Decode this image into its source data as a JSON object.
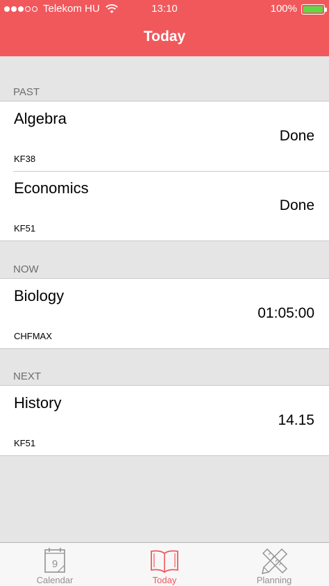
{
  "status_bar": {
    "carrier": "Telekom HU",
    "time": "13:10",
    "battery_percent": "100%",
    "signal_bars_filled": 3,
    "signal_bars_total": 5,
    "battery_level": 1.0
  },
  "nav": {
    "title": "Today"
  },
  "sections": [
    {
      "header": "PAST",
      "rows": [
        {
          "title": "Algebra",
          "status": "Done",
          "room": "KF38"
        },
        {
          "title": "Economics",
          "status": "Done",
          "room": "KF51"
        }
      ]
    },
    {
      "header": "NOW",
      "rows": [
        {
          "title": "Biology",
          "status": "01:05:00",
          "room": "CHFMAX"
        }
      ]
    },
    {
      "header": "NEXT",
      "rows": [
        {
          "title": "History",
          "status": "14.15",
          "room": "KF51"
        }
      ]
    }
  ],
  "tabbar": {
    "tabs": [
      {
        "label": "Calendar",
        "icon": "calendar-icon",
        "icon_text": "9"
      },
      {
        "label": "Today",
        "icon": "book-icon"
      },
      {
        "label": "Planning",
        "icon": "pencil-ruler-icon"
      }
    ],
    "active": "Today"
  },
  "colors": {
    "accent": "#f0585c",
    "background": "#e5e5e5",
    "tab_inactive": "#929292",
    "battery": "#5fd846"
  }
}
